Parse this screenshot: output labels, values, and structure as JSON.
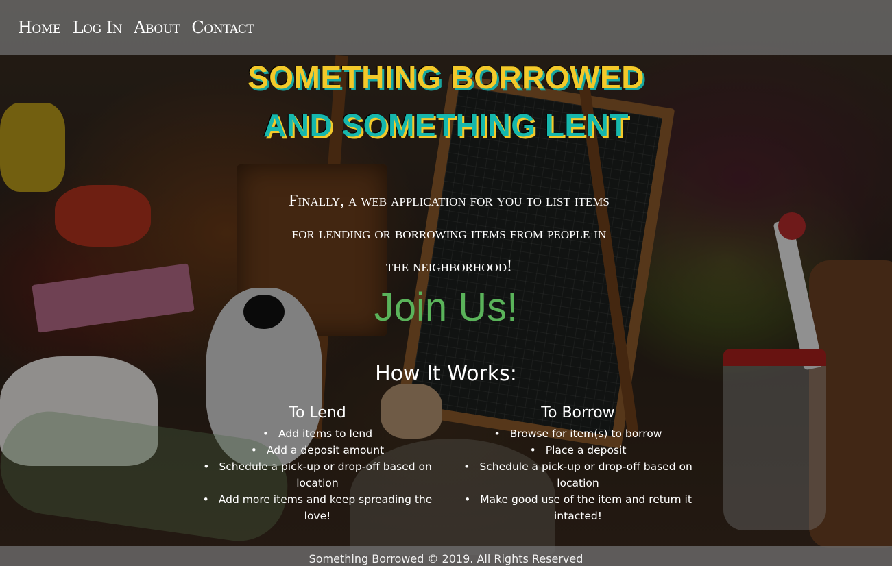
{
  "nav": {
    "items": [
      {
        "label": "Home"
      },
      {
        "label": "Log In"
      },
      {
        "label": "About"
      },
      {
        "label": "Contact"
      }
    ]
  },
  "hero": {
    "title_line1": "Something Borrowed",
    "title_line2": "And Something Lent",
    "tagline": "Finally, a web application for you to list items for lending or borrowing items from people in the neighborhood!",
    "join_label": "Join Us!"
  },
  "how_it_works": {
    "heading": "How It Works:",
    "lend": {
      "heading": "To Lend",
      "steps": [
        "Add items to lend",
        "Add a deposit amount",
        "Schedule a pick-up or drop-off based on location",
        "Add more items and keep spreading the love!"
      ]
    },
    "borrow": {
      "heading": "To Borrow",
      "steps": [
        "Browse for item(s) to borrow",
        "Place a deposit",
        "Schedule a pick-up or drop-off based on location",
        "Make good use of the item and return it intacted!"
      ]
    }
  },
  "footer": {
    "text": "Something Borrowed © 2019. All Rights Reserved"
  },
  "colors": {
    "title_gold": "#f3c92a",
    "title_teal": "#16b7ad",
    "join_green": "#5ab35a",
    "bar_gray": "#6e6e6e"
  }
}
